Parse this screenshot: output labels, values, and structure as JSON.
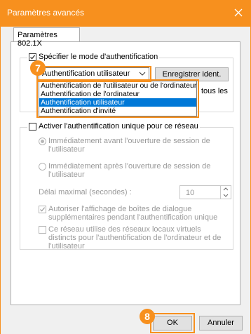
{
  "window": {
    "title": "Paramètres avancés",
    "close_icon": "close-icon"
  },
  "tab": {
    "label": "Paramètres 802.1X"
  },
  "auth_mode": {
    "label": "Spécifier le mode d'authentification",
    "checked": true,
    "selected": "Authentification utilisateur",
    "save_button": "Enregistrer ident.",
    "partial_text": "tous les",
    "options": [
      "Authentification de l'utilisateur ou de l'ordinateur",
      "Authentification de l'ordinateur",
      "Authentification utilisateur",
      "Authentification d'invité"
    ],
    "selected_index": 2
  },
  "sso": {
    "label": "Activer l'authentification unique pour ce réseau",
    "checked": false,
    "radio1": "Immédiatement avant l'ouverture de session de l'utilisateur",
    "radio2": "Immédiatement après l'ouverture de session de l'utilisateur",
    "delay_label": "Délai maximal (secondes) :",
    "delay_value": "10",
    "allow_dialogs": "Autoriser l'affichage de boîtes de dialogue supplémentaires pendant l'authentification unique",
    "vlan": "Ce réseau utilise des réseaux locaux virtuels distincts pour l'authentification de l'ordinateur et de l'utilisateur"
  },
  "buttons": {
    "ok": "OK",
    "cancel": "Annuler"
  },
  "badges": {
    "step7": "7",
    "step8": "8"
  },
  "colors": {
    "accent": "#f7901e",
    "selection": "#0078d7"
  }
}
